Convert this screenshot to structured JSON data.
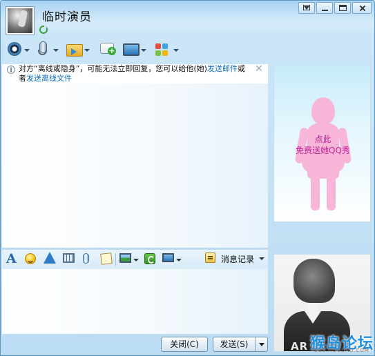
{
  "contact": {
    "name": "临时演员"
  },
  "info_bar": {
    "text_before": "对方“离线或隐身”，可能无法立即回复，您可以给他(她)",
    "link_mail": "发送邮件",
    "text_mid": "或者",
    "link_file": "发送离线文件",
    "close_glyph": "✕"
  },
  "format_bar": {
    "history_label": "消息记录"
  },
  "buttons": {
    "close_label": "关闭(C)",
    "send_label": "发送(S)"
  },
  "show_panel": {
    "line1": "点此",
    "line2": "免费送她QQ秀"
  },
  "avatar_shirt_text": "AR",
  "watermark": {
    "main": "猴岛论坛",
    "sub": "BBS.HOUDAO.COM"
  },
  "colors": {
    "link": "#0b6fc4",
    "show_text": "#c0239b",
    "silhouette": "#f7b5d8"
  }
}
